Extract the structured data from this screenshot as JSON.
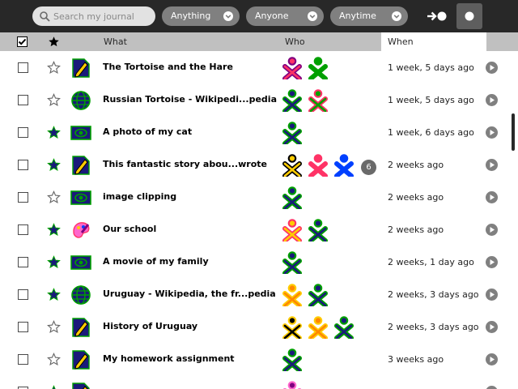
{
  "toolbar": {
    "search_placeholder": "Search my journal",
    "filters": [
      {
        "label": "Anything"
      },
      {
        "label": "Anyone"
      },
      {
        "label": "Anytime"
      }
    ]
  },
  "header": {
    "what": "What",
    "who": "Who",
    "when": "When"
  },
  "colors": {
    "toolbar": "#282828",
    "header": "#c0c0c0",
    "star_fill": "#1a1a7a",
    "activity_bg_blue": "#1a1a7a",
    "buddy_green": "#00a000",
    "buddy_yellow": "#ffcc00",
    "buddy_pink": "#ff3366",
    "buddy_blue": "#0040ff"
  },
  "rows": [
    {
      "title": "The Tortoise and the Hare",
      "when": "1 week, 5 days ago",
      "starred": false,
      "icon": "write-document-icon",
      "buddies": [
        [
          "#800080",
          "#ff3366"
        ],
        [
          "#00a000",
          "#00a000"
        ]
      ],
      "more": ""
    },
    {
      "title": "Russian Tortoise - Wikipedi...pedia",
      "when": "1 week, 5 days ago",
      "starred": false,
      "icon": "browse-globe-icon",
      "buddies": [
        [
          "#00a000",
          "#1a1a7a"
        ],
        [
          "#ff3366",
          "#00a000"
        ]
      ],
      "more": ""
    },
    {
      "title": "A photo of my cat",
      "when": "1 week, 6 days ago",
      "starred": true,
      "icon": "image-viewer-icon",
      "buddies": [
        [
          "#00a000",
          "#1a1a7a"
        ]
      ],
      "more": ""
    },
    {
      "title": "This fantastic story abou...wrote",
      "when": "2 weeks ago",
      "starred": true,
      "icon": "write-document-icon",
      "buddies": [
        [
          "#000000",
          "#ffcc00"
        ],
        [
          "#ff3366",
          "#ff3366"
        ],
        [
          "#0040ff",
          "#0040ff"
        ]
      ],
      "more": "6"
    },
    {
      "title": "image clipping",
      "when": "2 weeks ago",
      "starred": false,
      "icon": "image-viewer-icon",
      "buddies": [
        [
          "#00a000",
          "#1a1a7a"
        ]
      ],
      "more": ""
    },
    {
      "title": "Our school",
      "when": "2 weeks ago",
      "starred": true,
      "icon": "paint-icon",
      "buddies": [
        [
          "#ff3366",
          "#ffcc00"
        ],
        [
          "#00a000",
          "#1a1a7a"
        ]
      ],
      "more": ""
    },
    {
      "title": "A movie of my family",
      "when": "2 weeks, 1 day ago",
      "starred": true,
      "icon": "video-icon",
      "buddies": [
        [
          "#00a000",
          "#1a1a7a"
        ]
      ],
      "more": ""
    },
    {
      "title": "Uruguay - Wikipedia, the fr...pedia",
      "when": "2 weeks, 3 days ago",
      "starred": true,
      "icon": "browse-globe-icon",
      "buddies": [
        [
          "#ffcc00",
          "#ff8800"
        ],
        [
          "#00a000",
          "#1a1a7a"
        ]
      ],
      "more": ""
    },
    {
      "title": "History of Uruguay",
      "when": "2 weeks, 3 days ago",
      "starred": false,
      "icon": "write-document-icon",
      "buddies": [
        [
          "#ffcc00",
          "#000000"
        ],
        [
          "#ffcc00",
          "#ff8800"
        ],
        [
          "#00a000",
          "#1a1a7a"
        ]
      ],
      "more": ""
    },
    {
      "title": "My homework assignment",
      "when": "3 weeks ago",
      "starred": false,
      "icon": "write-document-icon",
      "buddies": [
        [
          "#00a000",
          "#1a1a7a"
        ]
      ],
      "more": ""
    },
    {
      "title": "",
      "when": "",
      "starred": true,
      "icon": "write-document-icon",
      "buddies": [
        [
          "#ff66cc",
          "#800080"
        ]
      ],
      "more": ""
    }
  ]
}
